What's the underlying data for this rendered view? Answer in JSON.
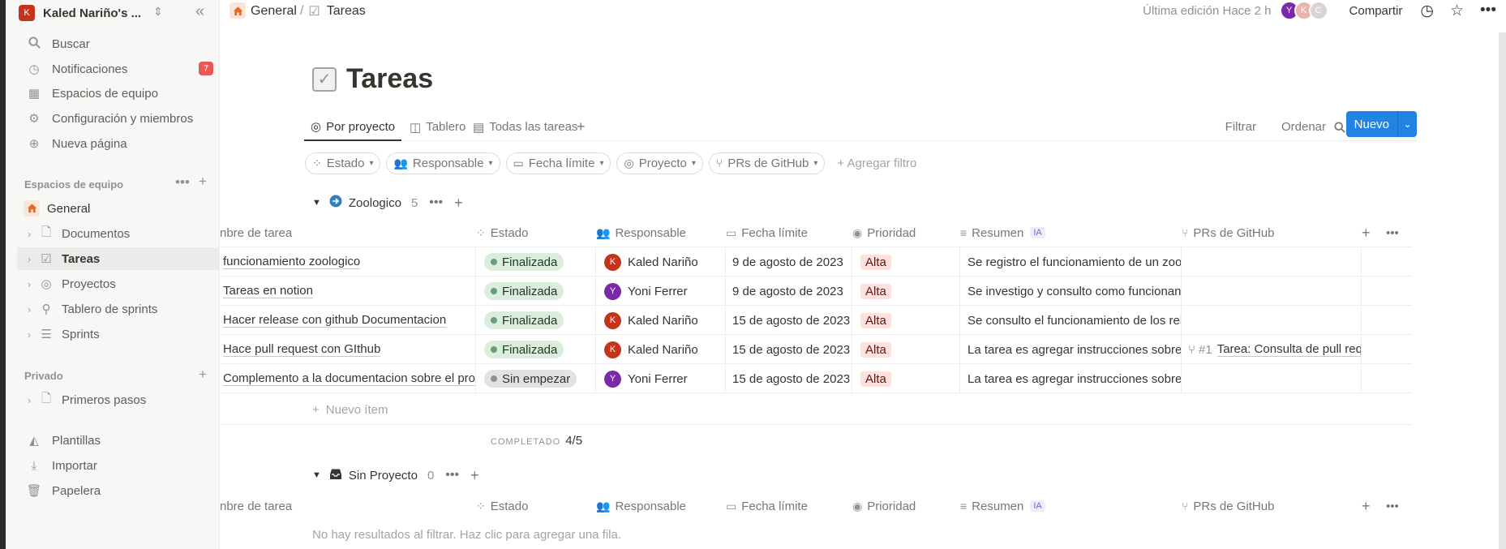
{
  "workspace": {
    "initial": "K",
    "name": "Kaled Nariño's ..."
  },
  "sidebar": {
    "nav": [
      {
        "label": "Buscar",
        "icon": "search-icon"
      },
      {
        "label": "Notificaciones",
        "icon": "clock-icon",
        "badge": "7"
      },
      {
        "label": "Espacios de equipo",
        "icon": "building-icon"
      },
      {
        "label": "Configuración y miembros",
        "icon": "gear-icon"
      },
      {
        "label": "Nueva página",
        "icon": "plus-circle-icon"
      }
    ],
    "teamspaces_title": "Espacios de equipo",
    "general": "General",
    "tree": [
      {
        "label": "Documentos",
        "icon": "page-icon"
      },
      {
        "label": "Tareas",
        "icon": "checkbox-icon"
      },
      {
        "label": "Proyectos",
        "icon": "target-icon"
      },
      {
        "label": "Tablero de sprints",
        "icon": "runner-icon"
      },
      {
        "label": "Sprints",
        "icon": "database-icon"
      }
    ],
    "private_title": "Privado",
    "private_items": [
      {
        "label": "Primeros pasos",
        "icon": "page-icon"
      }
    ],
    "bottom": [
      {
        "label": "Plantillas",
        "icon": "shapes-icon"
      },
      {
        "label": "Importar",
        "icon": "download-icon"
      },
      {
        "label": "Papelera",
        "icon": "trash-icon"
      }
    ]
  },
  "header": {
    "breadcrumb": [
      "General",
      "Tareas"
    ],
    "last_edited": "Última edición Hace 2 h",
    "avatars": [
      "Y",
      "K",
      "C"
    ],
    "share": "Compartir"
  },
  "page": {
    "title": "Tareas",
    "views": [
      "Por proyecto",
      "Tablero",
      "Todas las tareas"
    ],
    "filter": "Filtrar",
    "sort": "Ordenar",
    "new_button": "Nuevo",
    "filters": [
      "Estado",
      "Responsable",
      "Fecha límite",
      "Proyecto",
      "PRs de GitHub"
    ],
    "add_filter": "Agregar filtro"
  },
  "columns": [
    "nbre de tarea",
    "Estado",
    "Responsable",
    "Fecha límite",
    "Prioridad",
    "Resumen",
    "PRs de GitHub"
  ],
  "ia_tag": "IA",
  "groups": [
    {
      "name": "Zoologico",
      "count": "5",
      "rows": [
        {
          "task": "funcionamiento zoologico",
          "status": "Finalizada",
          "status_kind": "done",
          "assignee": "Kaled Nariño",
          "assignee_initial": "K",
          "assignee_color": "#c4341a",
          "due": "9 de agosto de 2023",
          "priority": "Alta",
          "summary": "Se registro el funcionamiento de un zoológico",
          "pr": ""
        },
        {
          "task": "Tareas en notion",
          "status": "Finalizada",
          "status_kind": "done",
          "assignee": "Yoni Ferrer",
          "assignee_initial": "Y",
          "assignee_color": "#7a2aa8",
          "due": "9 de agosto de 2023",
          "priority": "Alta",
          "summary": "Se investigo y consulto como funcionan las tareas",
          "pr": ""
        },
        {
          "task": "Hacer release con github Documentacion",
          "status": "Finalizada",
          "status_kind": "done",
          "assignee": "Kaled Nariño",
          "assignee_initial": "K",
          "assignee_color": "#c4341a",
          "due": "15 de agosto de 2023",
          "priority": "Alta",
          "summary": "Se consulto el funcionamiento de los releases",
          "pr": ""
        },
        {
          "task": "Hace pull request con GIthub",
          "status": "Finalizada",
          "status_kind": "done",
          "assignee": "Kaled Nariño",
          "assignee_initial": "K",
          "assignee_color": "#c4341a",
          "due": "15 de agosto de 2023",
          "priority": "Alta",
          "summary": "La tarea es agregar instrucciones sobre",
          "pr_num": "#1",
          "pr": "Tarea: Consulta de pull request"
        },
        {
          "task": "Complemento a la documentacion sobre el proyecto",
          "status": "Sin empezar",
          "status_kind": "todo",
          "assignee": "Yoni Ferrer",
          "assignee_initial": "Y",
          "assignee_color": "#7a2aa8",
          "due": "15 de agosto de 2023",
          "priority": "Alta",
          "summary": "La tarea es agregar instrucciones sobre",
          "pr": ""
        }
      ],
      "new_item": "Nuevo ítem",
      "completed_label": "COMPLETADO",
      "completed_value": "4/5"
    },
    {
      "name": "Sin Proyecto",
      "count": "0",
      "empty": "No hay resultados al filtrar. Haz clic para agregar una fila."
    }
  ]
}
